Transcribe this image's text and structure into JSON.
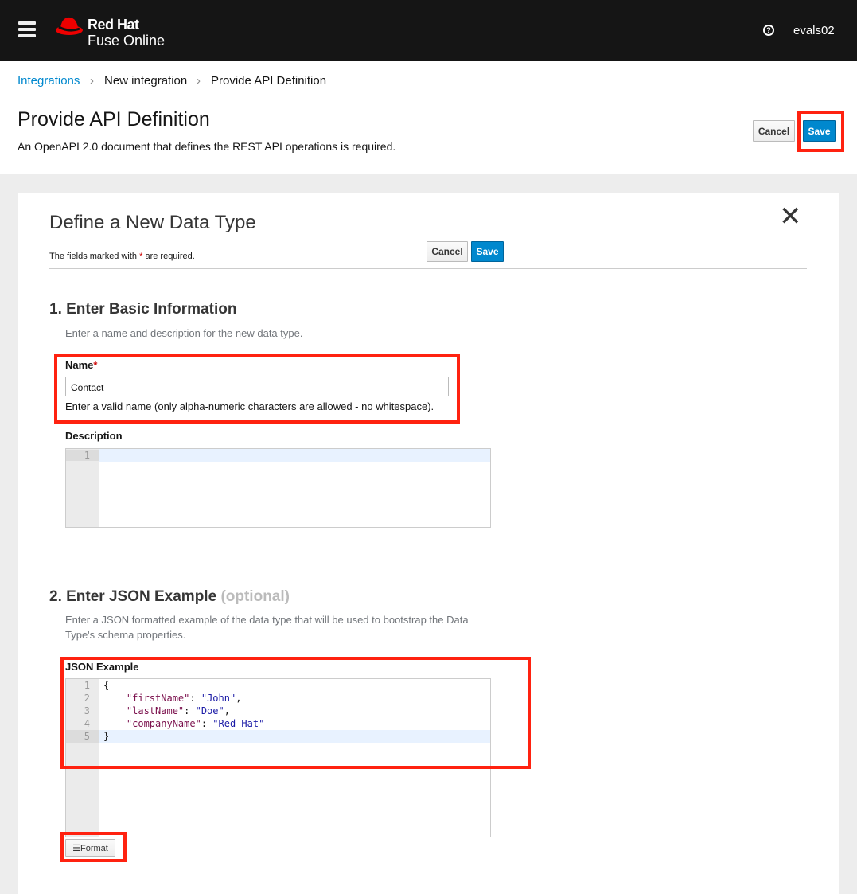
{
  "header": {
    "brand_line1": "Red Hat",
    "brand_line2": "Fuse Online",
    "username": "evals02"
  },
  "breadcrumb": [
    "Integrations",
    "New integration",
    "Provide API Definition"
  ],
  "page": {
    "title": "Provide API Definition",
    "subtitle": "An OpenAPI 2.0 document that defines the REST API operations is required.",
    "cancel": "Cancel",
    "save": "Save"
  },
  "dialog": {
    "title": "Define a New Data Type",
    "required_note": "The fields marked with",
    "required_note_end": "are required.",
    "asterisk": "*",
    "cancel": "Cancel",
    "save": "Save",
    "section1": {
      "title": "1. Enter Basic Information",
      "help": "Enter a name and description for the new data type.",
      "name_label": "Name",
      "name_value": "Contact",
      "name_help": "Enter a valid name (only alpha-numeric characters are allowed - no whitespace).",
      "desc_label": "Description",
      "desc_line": "1"
    },
    "section2": {
      "title": "2. Enter JSON Example",
      "optional": "(optional)",
      "help1": "Enter a JSON formatted example of the data type that will be used to bootstrap the Data",
      "help2": "Type's schema properties.",
      "label": "JSON Example",
      "format": "Format",
      "lines": [
        {
          "n": "1",
          "text": "{"
        },
        {
          "n": "2",
          "key": "\"firstName\"",
          "val": "\"John\"",
          "end": ","
        },
        {
          "n": "3",
          "key": "\"lastName\"",
          "val": "\"Doe\"",
          "end": ","
        },
        {
          "n": "4",
          "key": "\"companyName\"",
          "val": "\"Red Hat\"",
          "end": ""
        },
        {
          "n": "5",
          "text": "}"
        }
      ]
    }
  },
  "colors": {
    "highlight": "#ff2210",
    "primary": "#0088ce",
    "header_bg": "#151515"
  }
}
